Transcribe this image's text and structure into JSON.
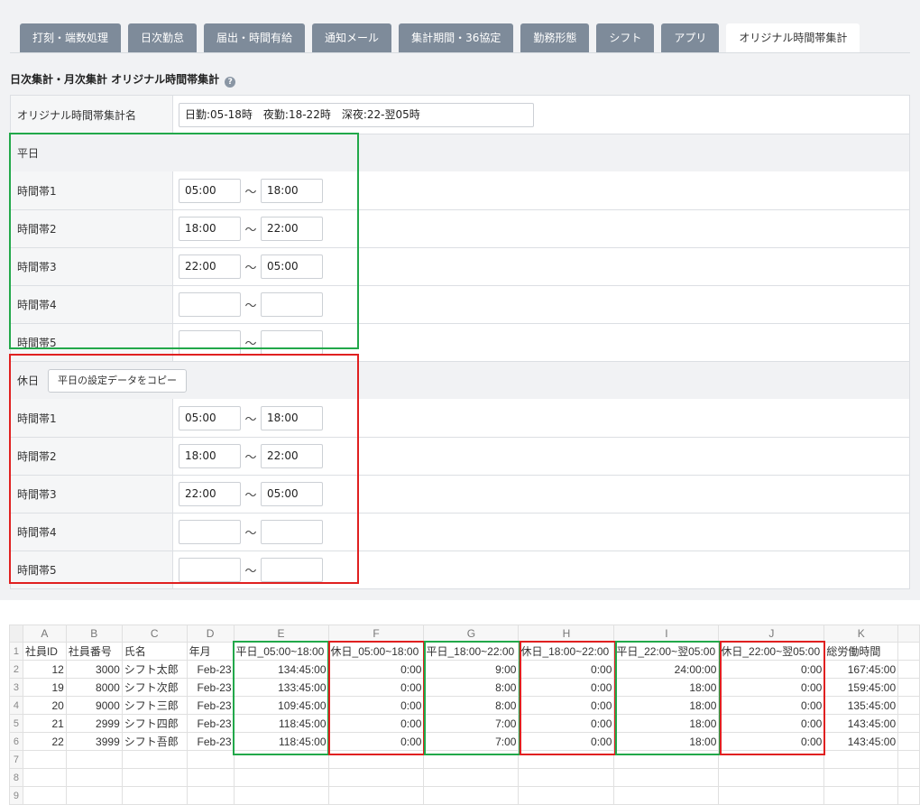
{
  "tabs": [
    "打刻・端数処理",
    "日次勤怠",
    "届出・時間有給",
    "通知メール",
    "集計期間・36協定",
    "勤務形態",
    "シフト",
    "アプリ",
    "オリジナル時間帯集計"
  ],
  "section_title": "日次集計・月次集計 オリジナル時間帯集計",
  "help_glyph": "?",
  "name_row": {
    "label": "オリジナル時間帯集計名",
    "value": "日勤:05-18時　夜勤:18-22時　深夜:22-翌05時"
  },
  "weekday": {
    "label": "平日",
    "slots": [
      {
        "label": "時間帯1",
        "from": "05:00",
        "to": "18:00"
      },
      {
        "label": "時間帯2",
        "from": "18:00",
        "to": "22:00"
      },
      {
        "label": "時間帯3",
        "from": "22:00",
        "to": "05:00"
      },
      {
        "label": "時間帯4",
        "from": "",
        "to": ""
      },
      {
        "label": "時間帯5",
        "from": "",
        "to": ""
      }
    ]
  },
  "holiday": {
    "label": "休日",
    "copy_button": "平日の設定データをコピー",
    "slots": [
      {
        "label": "時間帯1",
        "from": "05:00",
        "to": "18:00"
      },
      {
        "label": "時間帯2",
        "from": "18:00",
        "to": "22:00"
      },
      {
        "label": "時間帯3",
        "from": "22:00",
        "to": "05:00"
      },
      {
        "label": "時間帯4",
        "from": "",
        "to": ""
      },
      {
        "label": "時間帯5",
        "from": "",
        "to": ""
      }
    ]
  },
  "tilde": "〜",
  "highlight_colors": {
    "weekday": "#22a84a",
    "holiday": "#e02020"
  },
  "sheet": {
    "col_letters": [
      "A",
      "B",
      "C",
      "D",
      "E",
      "F",
      "G",
      "H",
      "I",
      "J",
      "K"
    ],
    "row_numbers": [
      "1",
      "2",
      "3",
      "4",
      "5",
      "6",
      "7",
      "8",
      "9"
    ],
    "headers": [
      "社員ID",
      "社員番号",
      "氏名",
      "年月",
      "平日_05:00~18:00",
      "休日_05:00~18:00",
      "平日_18:00~22:00",
      "休日_18:00~22:00",
      "平日_22:00~翌05:00",
      "休日_22:00~翌05:00",
      "総労働時間"
    ],
    "rows": [
      [
        "12",
        "3000",
        "シフト太郎",
        "Feb-23",
        "134:45:00",
        "0:00",
        "9:00",
        "0:00",
        "24:00:00",
        "0:00",
        "167:45:00"
      ],
      [
        "19",
        "8000",
        "シフト次郎",
        "Feb-23",
        "133:45:00",
        "0:00",
        "8:00",
        "0:00",
        "18:00",
        "0:00",
        "159:45:00"
      ],
      [
        "20",
        "9000",
        "シフト三郎",
        "Feb-23",
        "109:45:00",
        "0:00",
        "8:00",
        "0:00",
        "18:00",
        "0:00",
        "135:45:00"
      ],
      [
        "21",
        "2999",
        "シフト四郎",
        "Feb-23",
        "118:45:00",
        "0:00",
        "7:00",
        "0:00",
        "18:00",
        "0:00",
        "143:45:00"
      ],
      [
        "22",
        "3999",
        "シフト吾郎",
        "Feb-23",
        "118:45:00",
        "0:00",
        "7:00",
        "0:00",
        "18:00",
        "0:00",
        "143:45:00"
      ]
    ]
  }
}
